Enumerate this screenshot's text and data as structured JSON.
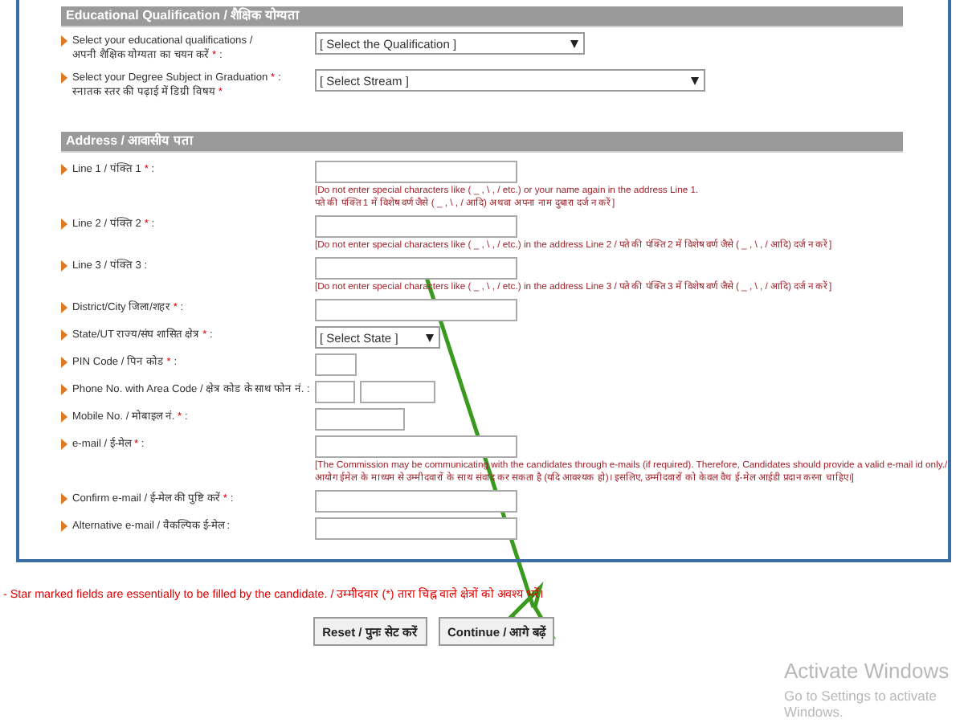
{
  "sections": [
    {
      "title": "Educational Qualification / शैक्षिक योग्यता",
      "rows": [
        {
          "kind": "select",
          "label": [
            [
              {
                "kind": "text",
                "text": "Select your educational qualifications /"
              }
            ],
            [
              {
                "kind": "text",
                "text": "अपनी शैक्षिक योग्यता का चयन करें"
              },
              {
                "kind": "star",
                "text": "*"
              },
              {
                "kind": "text",
                "text": ":"
              }
            ]
          ],
          "value": "[ Select the Qualification ]"
        },
        {
          "kind": "select",
          "label": [
            [
              {
                "kind": "text",
                "text": "Select your Degree Subject in Graduation"
              },
              {
                "kind": "star",
                "text": "*"
              },
              {
                "kind": "text",
                "text": ":"
              }
            ],
            [
              {
                "kind": "text",
                "text": "स्नातक स्तर की पढ़ाई में डिग्री विषय"
              },
              {
                "kind": "star",
                "text": "*"
              }
            ]
          ],
          "value": "[ Select Stream ]"
        }
      ]
    },
    {
      "title": "Address / आवासीय पता",
      "rows": [
        {
          "kind": "input",
          "label": [
            [
              {
                "kind": "text",
                "text": "Line 1 / पंक्ति 1"
              },
              {
                "kind": "star",
                "text": "*"
              },
              {
                "kind": "text",
                "text": ":"
              }
            ]
          ],
          "hint": [
            "[Do not enter special characters like ( _ , \\ , / etc.) or your name again in the address Line 1.",
            "पते की पंक्ति 1 में विशेष वर्ण जैसे ( _ , \\ , / आदि) अथवा अपना नाम दुबारा दर्ज न करें ]"
          ]
        },
        {
          "kind": "input",
          "label": [
            [
              {
                "kind": "text",
                "text": "Line 2 / पंक्ति 2"
              },
              {
                "kind": "star",
                "text": "*"
              },
              {
                "kind": "text",
                "text": ":"
              }
            ]
          ],
          "hint": [
            "[Do not enter special characters like ( _ , \\ , / etc.) in the address Line 2 / पते की पंक्ति 2 में विशेष वर्ण जैसे ( _ , \\ , / आदि) दर्ज न करें ]"
          ]
        },
        {
          "kind": "input",
          "label": [
            [
              {
                "kind": "text",
                "text": "Line 3 / पंक्ति 3 :"
              }
            ]
          ],
          "hint": [
            "[Do not enter special characters like ( _ , \\ , / etc.) in the address Line 3 / पते की पंक्ति 3 में विशेष वर्ण जैसे ( _ , \\ , / आदि) दर्ज न करें ]"
          ]
        },
        {
          "kind": "input",
          "label": [
            [
              {
                "kind": "text",
                "text": "District/City जिला/शहर"
              },
              {
                "kind": "star",
                "text": "*"
              },
              {
                "kind": "text",
                "text": ":"
              }
            ]
          ]
        },
        {
          "kind": "select",
          "label": [
            [
              {
                "kind": "text",
                "text": "State/UT राज्य/संघ शासित क्षेत्र"
              },
              {
                "kind": "star",
                "text": "*"
              },
              {
                "kind": "text",
                "text": ":"
              }
            ]
          ],
          "value": "[ Select State ]"
        },
        {
          "kind": "pin",
          "label": [
            [
              {
                "kind": "text",
                "text": "PIN Code / पिन कोड"
              },
              {
                "kind": "star",
                "text": "*"
              },
              {
                "kind": "text",
                "text": ":"
              }
            ]
          ]
        },
        {
          "kind": "phone",
          "label": [
            [
              {
                "kind": "text",
                "text": "Phone No. with Area Code / क्षेत्र कोड के साथ फोन नं. :"
              }
            ]
          ]
        },
        {
          "kind": "mobile",
          "label": [
            [
              {
                "kind": "text",
                "text": "Mobile No. / मोबाइल नं."
              },
              {
                "kind": "star",
                "text": "*"
              },
              {
                "kind": "text",
                "text": ":"
              }
            ]
          ]
        },
        {
          "kind": "input",
          "label": [
            [
              {
                "kind": "text",
                "text": "e-mail / ई-मेल"
              },
              {
                "kind": "star",
                "text": "*"
              },
              {
                "kind": "text",
                "text": ":"
              }
            ]
          ],
          "hint": [
            "[The Commission may be communicating with the candidates through e-mails (if required). Therefore, Candidates should provide a valid e-mail id only./",
            "आयोग ईमेल के माध्यम से उम्मीदवारों के साथ संवाद कर सकता है (यदि आवश्यक हो)। इसलिए, उम्मीदवारों को केवल वैध ई-मेल आईडी प्रदान करना चाहिए।]"
          ]
        },
        {
          "kind": "input",
          "label": [
            [
              {
                "kind": "text",
                "text": "Confirm e-mail / ई-मेल की पुष्टि करें"
              },
              {
                "kind": "star",
                "text": "*"
              },
              {
                "kind": "text",
                "text": ":"
              }
            ]
          ]
        },
        {
          "kind": "input",
          "label": [
            [
              {
                "kind": "text",
                "text": "Alternative e-mail / वैकल्पिक ई-मेल :"
              }
            ]
          ]
        }
      ]
    }
  ],
  "note": "- Star marked fields are essentially to be filled by the candidate. / उम्मीदवार (*) तारा चिह्न वाले क्षेत्रों को अवश्य भरें।",
  "buttons": [
    "Reset / पुनः सेट करें",
    "Continue / आगे बढ़ें"
  ],
  "windows_activation": {
    "title": "Activate Windows",
    "subtitle": "Go to Settings to activate Windows."
  }
}
